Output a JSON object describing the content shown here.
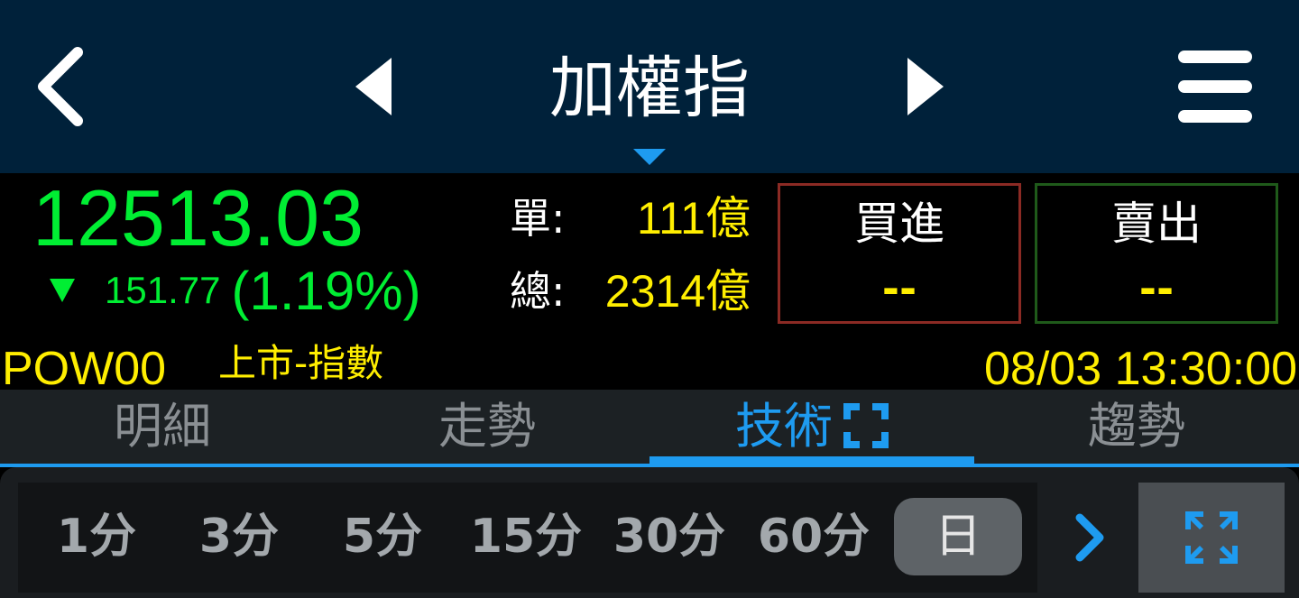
{
  "header": {
    "title": "加權指",
    "back_icon": "chevron-left-icon",
    "prev_icon": "triangle-left-icon",
    "next_icon": "triangle-right-icon",
    "menu_icon": "hamburger-menu-icon",
    "dropdown_icon": "triangle-down-icon",
    "bg_color": "#00213a"
  },
  "quote": {
    "price": "12513.03",
    "direction_icon": "triangle-down-icon",
    "change": "151.77",
    "change_pct": "(1.19%)",
    "price_color": "#00ee33",
    "single_label": "單:",
    "single_value": "111億",
    "total_label": "總:",
    "total_value": "2314億"
  },
  "trade": {
    "buy_label": "買進",
    "buy_value": "--",
    "sell_label": "賣出",
    "sell_value": "--"
  },
  "info": {
    "code": "POW00",
    "market": "上市-指數",
    "datetime": "08/03 13:30:00"
  },
  "tabs": [
    {
      "label": "明細",
      "active": false
    },
    {
      "label": "走勢",
      "active": false
    },
    {
      "label": "技術",
      "active": true
    },
    {
      "label": "趨勢",
      "active": false
    }
  ],
  "periods": [
    {
      "label": "1分",
      "active": false
    },
    {
      "label": "3分",
      "active": false
    },
    {
      "label": "5分",
      "active": false
    },
    {
      "label": "15分",
      "active": false
    },
    {
      "label": "30分",
      "active": false
    },
    {
      "label": "60分",
      "active": false
    },
    {
      "label": "日",
      "active": true
    }
  ],
  "accent_color": "#1e9bf0",
  "yellow_color": "#ffee00"
}
